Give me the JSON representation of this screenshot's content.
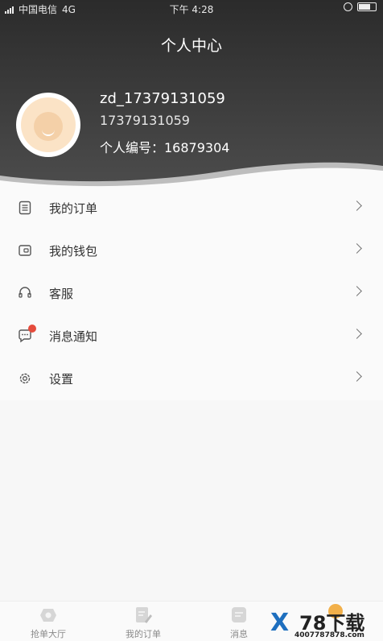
{
  "status_bar": {
    "carrier": "中国电信",
    "network": "4G",
    "time": "下午 4:28"
  },
  "header": {
    "title": "个人中心"
  },
  "profile": {
    "username": "zd_17379131059",
    "phone": "17379131059",
    "member_id": "个人编号：16879304",
    "avatar_icon": "default-avatar-icon"
  },
  "menu": {
    "items": [
      {
        "label": "我的订单",
        "icon": "order-list-icon"
      },
      {
        "label": "我的钱包",
        "icon": "wallet-icon"
      },
      {
        "label": "客服",
        "icon": "headset-icon"
      },
      {
        "label": "消息通知",
        "icon": "chat-bubble-icon",
        "has_badge": true
      },
      {
        "label": "设置",
        "icon": "gear-icon"
      }
    ]
  },
  "tabbar": {
    "tabs": [
      {
        "label": "抢单大厅",
        "icon": "hall-icon"
      },
      {
        "label": "我的订单",
        "icon": "edit-doc-icon"
      },
      {
        "label": "消息",
        "icon": "message-icon"
      }
    ]
  },
  "watermark": {
    "logo_text": "X",
    "title": "78下载",
    "phone": "4007787878.com"
  },
  "colors": {
    "header_dark": "#2b2b2b",
    "badge_red": "#e54b3c",
    "watermark_blue": "#1e6fbf"
  }
}
